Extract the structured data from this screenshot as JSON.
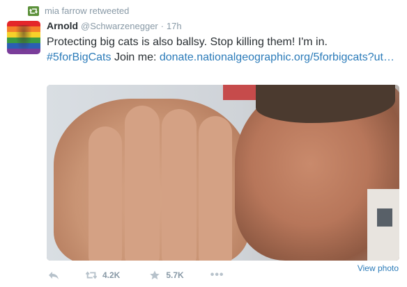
{
  "retweet": {
    "label": "mia farrow retweeted"
  },
  "tweet": {
    "name": "Arnold",
    "handle": "@Schwarzenegger",
    "separator": "·",
    "time": "17h",
    "text_line1": "Protecting big cats is also ballsy. Stop killing them! I'm in.",
    "hashtag": "#5forBigCats",
    "join_text": " Join me: ",
    "link": "donate.nationalgeographic.org/5forbigcats?ut…"
  },
  "actions": {
    "retweets": "4.2K",
    "favorites": "5.7K",
    "more": "•••",
    "view_photo": "View photo"
  },
  "colors": {
    "link": "#2b7bb9",
    "muted": "#8899a6",
    "retweet_badge": "#5c913b"
  },
  "icons": [
    "retweet-badge-icon",
    "reply-icon",
    "retweet-icon",
    "favorite-star-icon",
    "more-icon"
  ]
}
